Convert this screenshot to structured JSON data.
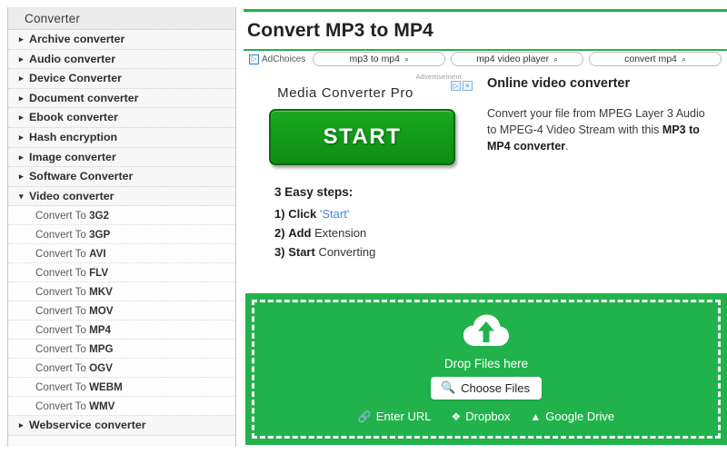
{
  "sidebar": {
    "header": "Converter",
    "top_items": [
      {
        "label": "Archive converter",
        "expanded": false
      },
      {
        "label": "Audio converter",
        "expanded": false
      },
      {
        "label": "Device Converter",
        "expanded": false
      },
      {
        "label": "Document converter",
        "expanded": false
      },
      {
        "label": "Ebook converter",
        "expanded": false
      },
      {
        "label": "Hash encryption",
        "expanded": false
      },
      {
        "label": "Image converter",
        "expanded": false
      },
      {
        "label": "Software Converter",
        "expanded": false
      },
      {
        "label": "Video converter",
        "expanded": true
      }
    ],
    "video_sub_items": [
      {
        "prefix": "Convert To ",
        "format": "3G2"
      },
      {
        "prefix": "Convert To ",
        "format": "3GP"
      },
      {
        "prefix": "Convert To ",
        "format": "AVI"
      },
      {
        "prefix": "Convert To ",
        "format": "FLV"
      },
      {
        "prefix": "Convert To ",
        "format": "MKV"
      },
      {
        "prefix": "Convert To ",
        "format": "MOV"
      },
      {
        "prefix": "Convert To ",
        "format": "MP4"
      },
      {
        "prefix": "Convert To ",
        "format": "MPG"
      },
      {
        "prefix": "Convert To ",
        "format": "OGV"
      },
      {
        "prefix": "Convert To ",
        "format": "WEBM"
      },
      {
        "prefix": "Convert To ",
        "format": "WMV"
      }
    ],
    "last_item": {
      "label": "Webservice converter",
      "expanded": false
    },
    "collapsed_arrow": "▸",
    "expanded_arrow": "▾"
  },
  "main": {
    "page_title": "Convert MP3 to MP4",
    "accent_color": "#22b24c"
  },
  "adstrip": {
    "adchoices_label": "AdChoices",
    "adchoices_icon": "adchoices-triangle-icon",
    "search_icon": "search-icon",
    "pills": [
      {
        "text": "mp3 to mp4"
      },
      {
        "text": "mp4 video player"
      },
      {
        "text": "convert mp4"
      }
    ]
  },
  "advertisement": {
    "label": "Advertisement",
    "title": "Media Converter Pro",
    "button_label": "START",
    "badge_info": "▷",
    "badge_close": "×"
  },
  "steps": {
    "title": "3 Easy steps:",
    "items": [
      {
        "num": "1)",
        "keyword": "Click",
        "rest": "",
        "link": "'Start'"
      },
      {
        "num": "2)",
        "keyword": "Add",
        "rest": "Extension",
        "link": ""
      },
      {
        "num": "3)",
        "keyword": "Start",
        "rest": "Converting",
        "link": ""
      }
    ]
  },
  "description": {
    "title": "Online video converter",
    "text_part1": "Convert your file from MPEG Layer 3 Audio to MPEG-4 Video Stream with this ",
    "text_bold": "MP3 to MP4 converter",
    "text_part2": "."
  },
  "dropzone": {
    "cloud_icon": "cloud-upload-icon",
    "drop_label": "Drop Files here",
    "choose_files_label": "Choose Files",
    "choose_files_icon": "search-icon",
    "links": [
      {
        "label": "Enter URL",
        "icon": "link-icon"
      },
      {
        "label": "Dropbox",
        "icon": "dropbox-icon"
      },
      {
        "label": "Google Drive",
        "icon": "google-drive-icon"
      }
    ],
    "background_color": "#22b24c"
  }
}
